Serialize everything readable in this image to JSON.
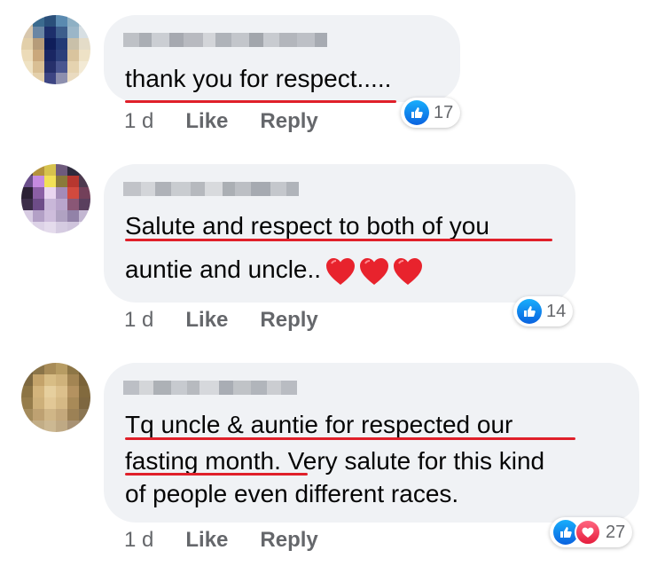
{
  "comments": [
    {
      "text_lines": [
        "thank you for respect....."
      ],
      "time": "1 d",
      "like_label": "Like",
      "reply_label": "Reply",
      "reactions": {
        "types": [
          "like-icon"
        ],
        "count": "17"
      }
    },
    {
      "text_lines": [
        "Salute and respect to both of you",
        "auntie and uncle.."
      ],
      "emoji": "❤️❤️❤️",
      "time": "1 d",
      "like_label": "Like",
      "reply_label": "Reply",
      "reactions": {
        "types": [
          "like-icon"
        ],
        "count": "14"
      }
    },
    {
      "text_lines": [
        "Tq uncle & auntie for respected our",
        "fasting month. Very salute for this kind",
        "of people even different races."
      ],
      "time": "1 d",
      "like_label": "Like",
      "reply_label": "Reply",
      "reactions": {
        "types": [
          "like-icon",
          "heart-icon"
        ],
        "count": "27"
      }
    }
  ],
  "colors": {
    "bubble": "#f0f2f5",
    "underline": "#e0202a",
    "meta": "#65676b",
    "like": "#1877f2",
    "love": "#f33e58"
  }
}
